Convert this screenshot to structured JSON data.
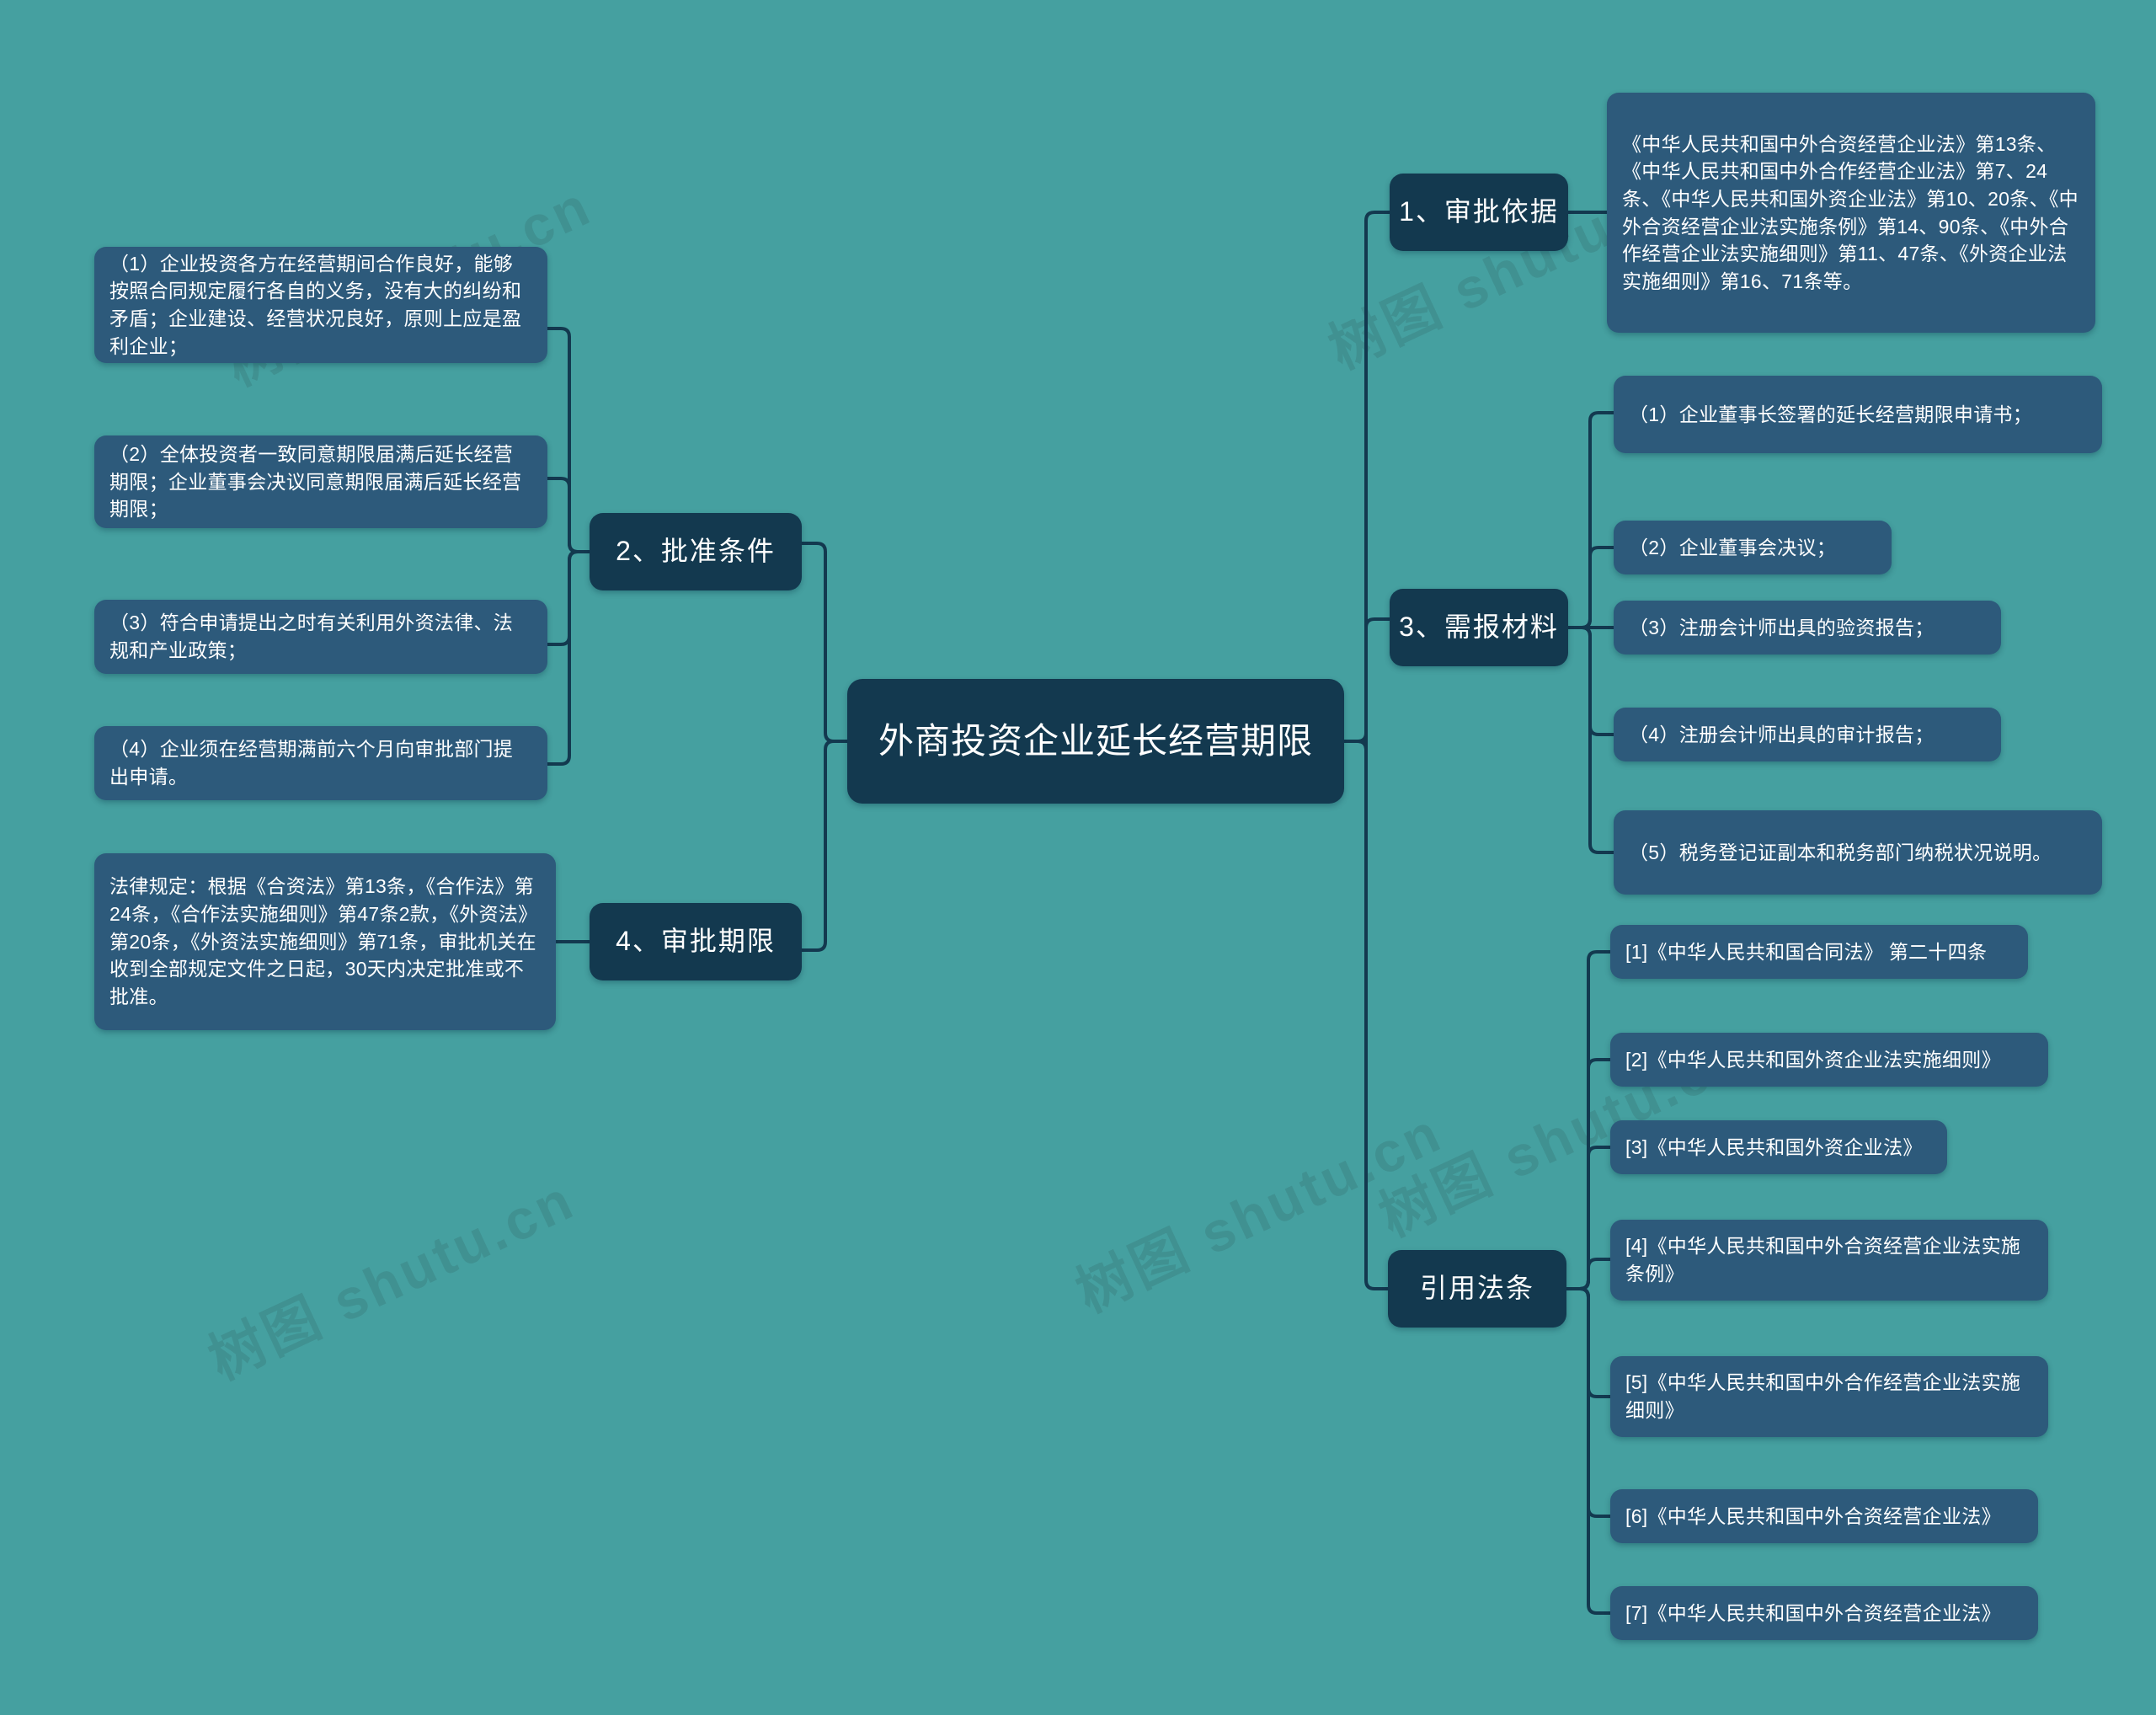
{
  "background_color": "#45a0a0",
  "node_color_leaf": "#2d5a7b",
  "node_color_branch": "#13394f",
  "link_color": "#13394f",
  "text_color": "#ffffff",
  "watermark": {
    "text": "树图 shutu.cn",
    "color": "#3e8888"
  },
  "root": {
    "label": "外商投资企业延长经营期限"
  },
  "branches": {
    "approval_basis": {
      "label": "1、审批依据",
      "items": [
        "《中华人民共和国中外合资经营企业法》第13条、《中华人民共和国中外合作经营企业法》第7、24条、《中华人民共和国外资企业法》第10、20条、《中外合资经营企业法实施条例》第14、90条、《中外合作经营企业法实施细则》第11、47条、《外资企业法实施细则》第16、71条等。"
      ]
    },
    "approval_conditions": {
      "label": "2、批准条件",
      "items": [
        "（1）企业投资各方在经营期间合作良好，能够按照合同规定履行各自的义务，没有大的纠纷和矛盾；企业建设、经营状况良好，原则上应是盈利企业；",
        "（2）全体投资者一致同意期限届满后延长经营期限；企业董事会决议同意期限届满后延长经营期限；",
        "（3）符合申请提出之时有关利用外资法律、法规和产业政策；",
        "（4）企业须在经营期满前六个月向审批部门提出申请。"
      ]
    },
    "required_materials": {
      "label": "3、需报材料",
      "items": [
        "（1）企业董事长签署的延长经营期限申请书；",
        "（2）企业董事会决议；",
        "（3）注册会计师出具的验资报告；",
        "（4）注册会计师出具的审计报告；",
        "（5）税务登记证副本和税务部门纳税状况说明。"
      ]
    },
    "approval_deadline": {
      "label": "4、审批期限",
      "items": [
        "法律规定：根据《合资法》第13条，《合作法》第24条，《合作法实施细则》第47条2款，《外资法》第20条，《外资法实施细则》第71条，审批机关在收到全部规定文件之日起，30天内决定批准或不批准。"
      ]
    },
    "cited_laws": {
      "label": "引用法条",
      "items": [
        "[1]《中华人民共和国合同法》 第二十四条",
        "[2]《中华人民共和国外资企业法实施细则》",
        "[3]《中华人民共和国外资企业法》",
        "[4]《中华人民共和国中外合资经营企业法实施条例》",
        "[5]《中华人民共和国中外合作经营企业法实施细则》",
        "[6]《中华人民共和国中外合资经营企业法》",
        "[7]《中华人民共和国中外合资经营企业法》"
      ]
    }
  }
}
